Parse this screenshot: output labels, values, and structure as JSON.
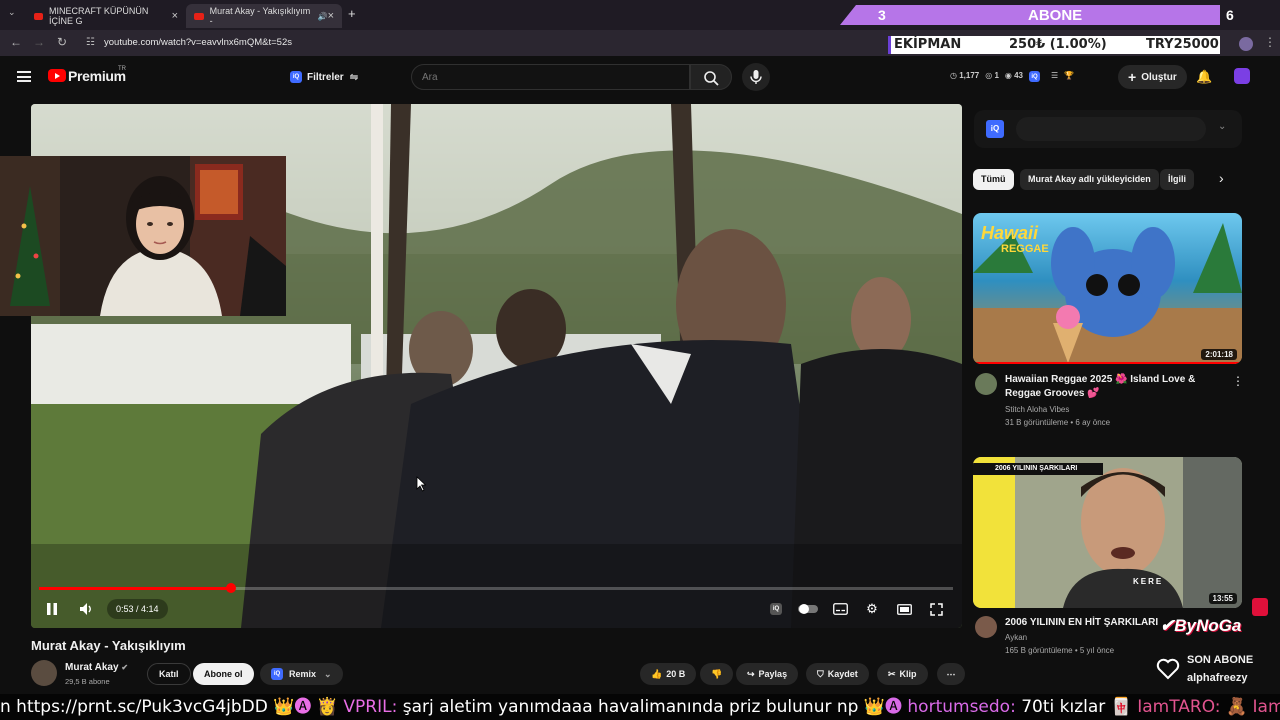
{
  "browser": {
    "tabs": [
      {
        "title": "MINECRAFT KÜPÜNÜN İÇİNE G"
      },
      {
        "title": "Murat Akay - Yakışıklıyım -"
      }
    ],
    "new_tab_icon": "plus-icon",
    "url": "youtube.com/watch?v=eavvlnx6mQM&t=52s"
  },
  "overlay": {
    "subscriber_count": "3",
    "subscriber_label": "ABONE",
    "subscriber_goal": "6",
    "equipment": {
      "label": "EKİPMAN",
      "amount": "250₺ (1.00%)",
      "goal": "TRY25000"
    },
    "last_subscriber": {
      "label": "SON ABONE",
      "name": "alphafreezy"
    }
  },
  "header": {
    "logo_text": "Premium",
    "region": "TR",
    "filters_label": "Filtreler",
    "search_placeholder": "Ara",
    "stats": [
      "1,177",
      "1",
      "43"
    ],
    "create_label": "Oluştur"
  },
  "player": {
    "time_label": "0:53 / 4:14",
    "progress": 0.21
  },
  "video": {
    "title": "Murat Akay - Yakışıklıyım",
    "channel": "Murat Akay",
    "subscribers": "29,5 B abone",
    "join_label": "Katıl",
    "subscribe_label": "Abone ol",
    "remix_label": "Remix",
    "likes": "20 B",
    "share_label": "Paylaş",
    "save_label": "Kaydet",
    "clip_label": "Klip"
  },
  "sidebar": {
    "chips": [
      "Tümü",
      "Murat Akay adlı yükleyiciden",
      "İlgili"
    ],
    "recommendations": [
      {
        "title": "Hawaiian Reggae 2025 🌺 Island Love & Reggae Grooves 💕",
        "channel": "Stitch Aloha Vibes",
        "meta": "31 B görüntüleme • 6 ay önce",
        "duration": "2:01:18",
        "thumb_text_1": "Hawaii",
        "thumb_text_2": "REGGAE"
      },
      {
        "title": "2006 YILININ EN HİT ŞARKILARI",
        "channel": "Aykan",
        "meta": "165 B görüntüleme • 5 yıl önce",
        "duration": "13:55",
        "thumb_text_1": "2006 YILININ ŞARKILARI",
        "thumb_text_2": "KERE"
      }
    ]
  },
  "chat": {
    "ticker_segments": [
      {
        "text": "n https://prnt.sc/Puk3vcG4jbDD ",
        "color": "#ffffff"
      },
      {
        "text": "👑🅐 👸 VPRIL: ",
        "color": "#e96ee6"
      },
      {
        "text": "şarj aletim yanımdaaa havalimanında priz bulunur np ",
        "color": "#ffffff"
      },
      {
        "text": "👑🅐 hortumsedo: ",
        "color": "#d96ae8"
      },
      {
        "text": "70ti kızlar ",
        "color": "#ffffff"
      },
      {
        "text": "🀄 IamTARO: 🧸 IamTARO: 🧸",
        "color": "#e1548f"
      }
    ]
  },
  "colors": {
    "accent": "#ff0000",
    "overlay_purple": "#b675e8",
    "iq_blue": "#3f6bff"
  }
}
